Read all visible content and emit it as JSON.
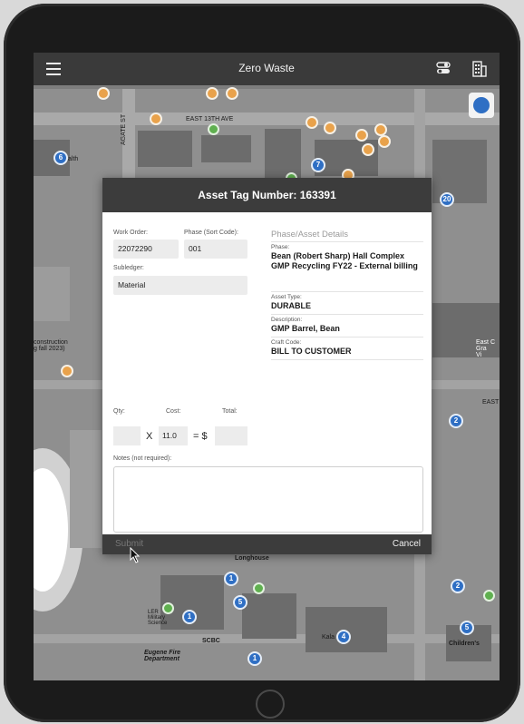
{
  "app": {
    "title": "Zero Waste"
  },
  "nav_icons": {
    "left": "hamburger-menu-icon",
    "right1": "toggle-icon",
    "right2": "building-icon"
  },
  "map": {
    "labels": {
      "street_east_13th": "EAST 13TH AVE",
      "street_agate": "AGATE ST",
      "construction": "construction\ng fall 2023)",
      "east_edge": "EAST",
      "longhouse": "Longhouse",
      "scbc": "SCBC",
      "eugene_fire": "Eugene Fire\nDepartment",
      "ler": "LER\nMilitary\nScience",
      "health": "alth",
      "kalapuya": "Kala",
      "childrens": "Children's",
      "east_gra": "East C\nGra\nVi"
    },
    "blue_pins": [
      "6",
      "7",
      "20",
      "2",
      "1",
      "5",
      "1",
      "4",
      "1",
      "2",
      "5"
    ],
    "colors": {
      "orange": "#e9a24b",
      "blue": "#2f6fc4",
      "green": "#5fb04f"
    }
  },
  "dialog": {
    "title": "Asset Tag Number: 163391",
    "work_order_label": "Work Order:",
    "work_order_value": "22072290",
    "phase_label": "Phase (Sort Code):",
    "phase_value": "001",
    "subledger_label": "Subledger:",
    "subledger_value": "Material",
    "details_title": "Phase/Asset Details",
    "details": [
      {
        "label": "Phase:",
        "value": "Bean (Robert Sharp) Hall Complex GMP Recycling FY22 - External billing"
      },
      {
        "label": "Asset Type:",
        "value": "DURABLE"
      },
      {
        "label": "Description:",
        "value": "GMP Barrel, Bean"
      },
      {
        "label": "Craft Code:",
        "value": "BILL TO CUSTOMER"
      }
    ],
    "qty_label": "Qty:",
    "cost_label": "Cost:",
    "total_label": "Total:",
    "qty_value": "",
    "cost_value": "11.0",
    "total_value": "",
    "times_symbol": "X",
    "equals_symbol": "= $",
    "notes_label": "Notes (not required):",
    "notes_value": "",
    "submit_label": "Submit",
    "cancel_label": "Cancel"
  }
}
